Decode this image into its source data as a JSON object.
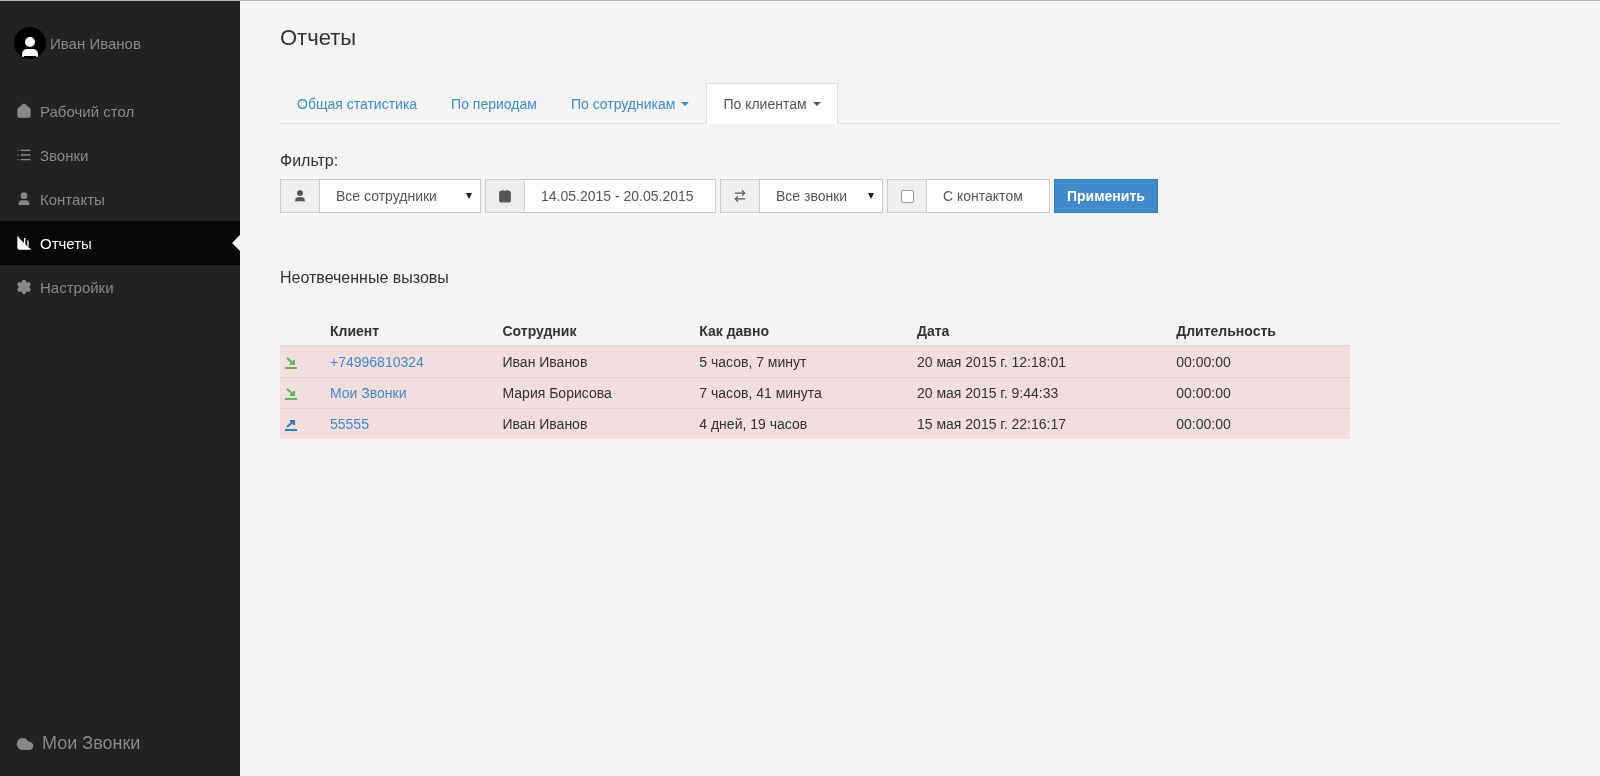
{
  "user": {
    "name": "Иван Иванов"
  },
  "sidebar": {
    "items": [
      {
        "label": "Рабочий стол",
        "kind": "home",
        "selected": false
      },
      {
        "label": "Звонки",
        "kind": "list",
        "selected": false
      },
      {
        "label": "Контакты",
        "kind": "person",
        "selected": false
      },
      {
        "label": "Отчеты",
        "kind": "chart",
        "selected": true
      },
      {
        "label": "Настройки",
        "kind": "gear",
        "selected": false
      }
    ],
    "footer": "Мои Звонки"
  },
  "page_title": "Отчеты",
  "tabs": [
    {
      "label": "Общая статистика",
      "dropdown": false,
      "selected": false
    },
    {
      "label": "По периодам",
      "dropdown": false,
      "selected": false
    },
    {
      "label": "По сотрудникам",
      "dropdown": true,
      "selected": false
    },
    {
      "label": "По клиентам",
      "dropdown": true,
      "selected": true
    }
  ],
  "filter": {
    "label": "Фильтр:",
    "groups": [
      {
        "kind": "employee",
        "value": "Все сотрудники"
      },
      {
        "kind": "date",
        "value": "14.05.2015 - 20.05.2015"
      },
      {
        "kind": "call_type",
        "value": "Все звонки"
      },
      {
        "kind": "checkbox",
        "checked": false,
        "value": "С контактом"
      }
    ],
    "apply": "Применить"
  },
  "section_title": "Неотвеченные вызовы",
  "table": {
    "columns": [
      "Клиент",
      "Сотрудник",
      "Как давно",
      "Дата",
      "Длительность"
    ],
    "rows": [
      {
        "kind": "incoming",
        "cells": [
          "+74996810324",
          "Иван Иванов",
          "5 часов, 7 минут",
          "20 мая 2015 г. 12:18:01",
          "00:00:00"
        ]
      },
      {
        "kind": "incoming",
        "cells": [
          "Мои Звонки",
          "Мария Борисова",
          "7 часов, 41 минута",
          "20 мая 2015 г. 9:44:33",
          "00:00:00"
        ]
      },
      {
        "kind": "outgoing",
        "cells": [
          "55555",
          "Иван Иванов",
          "4 дней, 19 часов",
          "15 мая 2015 г. 22:16:17",
          "00:00:00"
        ]
      }
    ]
  }
}
